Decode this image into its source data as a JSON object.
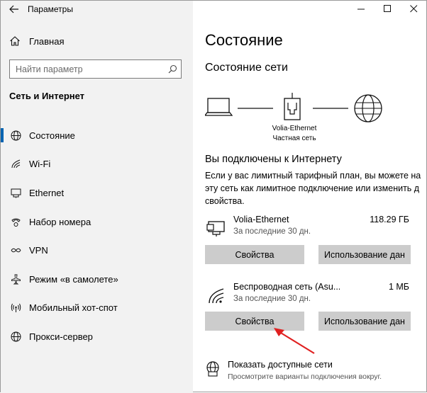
{
  "window": {
    "title": "Параметры"
  },
  "sidebar": {
    "home": "Главная",
    "search_placeholder": "Найти параметр",
    "section": "Сеть и Интернет",
    "items": [
      {
        "label": "Состояние",
        "icon": "globe-icon",
        "active": true
      },
      {
        "label": "Wi-Fi",
        "icon": "wifi-icon"
      },
      {
        "label": "Ethernet",
        "icon": "ethernet-icon"
      },
      {
        "label": "Набор номера",
        "icon": "phone-icon"
      },
      {
        "label": "VPN",
        "icon": "vpn-icon"
      },
      {
        "label": "Режим «в самолете»",
        "icon": "airplane-icon"
      },
      {
        "label": "Мобильный хот-спот",
        "icon": "hotspot-icon"
      },
      {
        "label": "Прокси-сервер",
        "icon": "proxy-globe-icon"
      }
    ]
  },
  "main": {
    "title": "Состояние",
    "subtitle": "Состояние сети",
    "diagram": {
      "name": "Volia-Ethernet",
      "type": "Частная сеть"
    },
    "connected_heading": "Вы подключены к Интернету",
    "desc_lines": [
      "Если у вас лимитный тарифный план, вы можете на",
      "эту сеть как лимитное подключение или изменить д",
      "свойства."
    ],
    "connections": [
      {
        "name": "Volia-Ethernet",
        "period": "За последние 30 дн.",
        "size": "118.29 ГБ",
        "properties_label": "Свойства",
        "usage_label": "Использование дан"
      },
      {
        "name": "Беспроводная сеть (Asu...",
        "period": "За последние 30 дн.",
        "size": "1 МБ",
        "properties_label": "Свойства",
        "usage_label": "Использование дан"
      }
    ],
    "show_networks": {
      "title": "Показать доступные сети",
      "subtitle": "Просмотрите варианты подключения вокруг."
    }
  },
  "colors": {
    "accent": "#0063b1",
    "arrow": "#e02020",
    "button": "#cccccc",
    "sidebar": "#f2f2f2"
  }
}
